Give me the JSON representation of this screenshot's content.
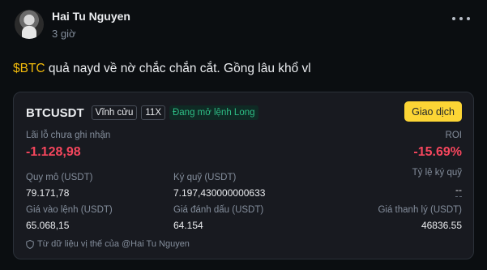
{
  "post": {
    "author": "Hai Tu Nguyen",
    "time": "3 giờ",
    "text_ticker": "$BTC",
    "text_body": " quả nayd về nờ chắc chắn cắt. Gồng lâu khổ vl"
  },
  "card": {
    "symbol": "BTCUSDT",
    "tag_contract": "Vĩnh cửu",
    "tag_leverage": "11X",
    "tag_position": "Đang mở lệnh Long",
    "trade_button": "Giao dịch",
    "pnl_label": "Lãi lỗ chưa ghi nhận",
    "pnl_value": "-1.128,98",
    "roi_label": "ROI",
    "roi_value": "-15.69%",
    "size_label": "Quy mô (USDT)",
    "size_value": "79.171,78",
    "margin_label": "Ký quỹ (USDT)",
    "margin_value": "7.197,430000000633",
    "margin_ratio_label": "Tỷ lệ ký quỹ",
    "margin_ratio_value": "--",
    "entry_label": "Giá vào lệnh (USDT)",
    "entry_value": "65.068,15",
    "mark_label": "Giá đánh dấu (USDT)",
    "mark_value": "64.154",
    "liq_label": "Giá thanh lý (USDT)",
    "liq_value": "46836.55",
    "footer": "Từ dữ liệu vị thế của @Hai Tu Nguyen"
  },
  "colors": {
    "accent": "#fcd535",
    "ticker": "#f0b90b",
    "loss": "#f6465d",
    "long": "#2ebd85",
    "background": "#0b0e11",
    "card": "#181a20"
  },
  "icons": [
    "more-icon",
    "shield-icon"
  ]
}
